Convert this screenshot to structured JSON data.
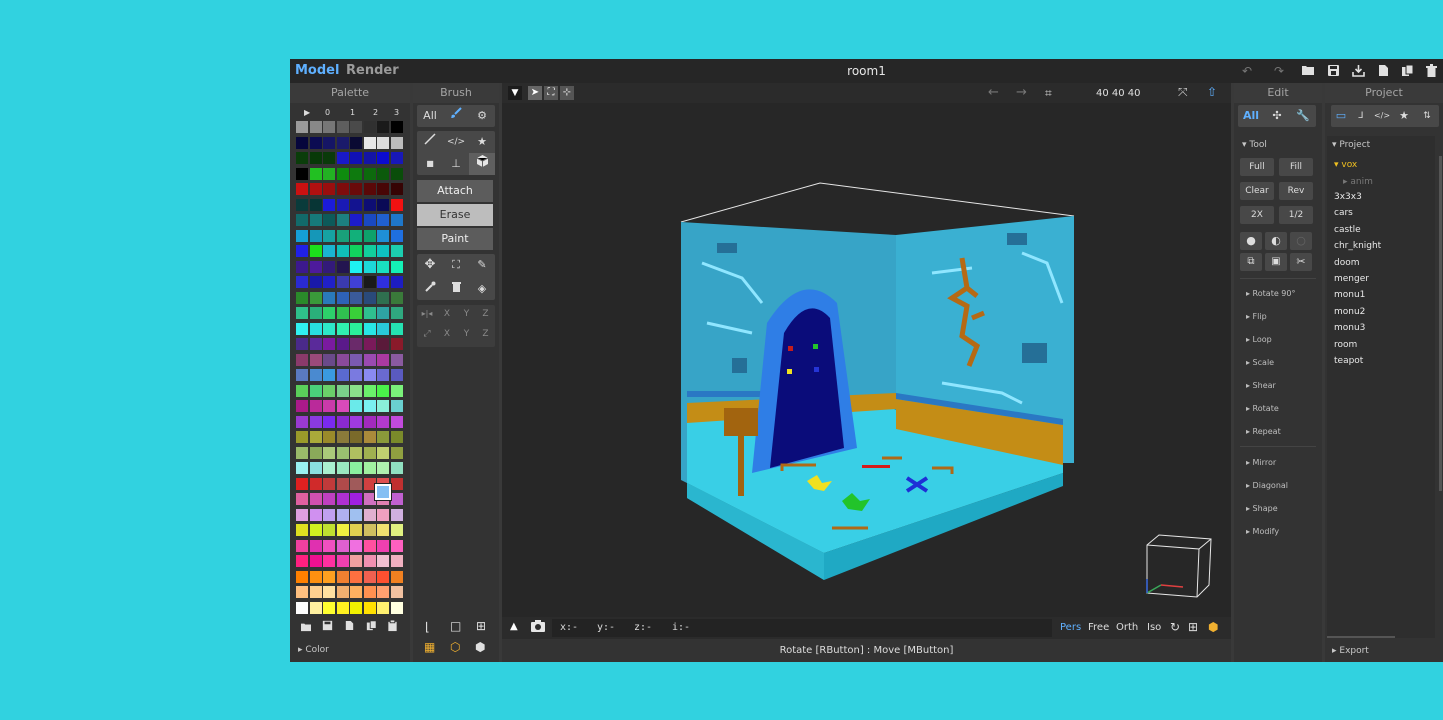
{
  "topbar": {
    "tabs": [
      "Model",
      "Render"
    ],
    "title": "room1"
  },
  "palette": {
    "title": "Palette",
    "columns": [
      "▶",
      "0",
      "1",
      "2",
      "3"
    ],
    "sub_label": "▸ Color",
    "colors": [
      "#9b9b9b",
      "#888888",
      "#777777",
      "#5e5e5e",
      "#4a4a4a",
      "#303030",
      "#1a1a1a",
      "#000000",
      "#06063c",
      "#0b0b52",
      "#151565",
      "#1a1a6b",
      "#0a0a33",
      "#e8e8e8",
      "#dedede",
      "#bcbcbc",
      "#0a3d0a",
      "#083908",
      "#0a3a0a",
      "#1919c8",
      "#1010b5",
      "#1414a5",
      "#0b0bd0",
      "#1818b8",
      "#000000",
      "#22c022",
      "#23b123",
      "#0e8c0e",
      "#0e7a0e",
      "#0d6a0d",
      "#0b5a0b",
      "#0a4d0a",
      "#cc1111",
      "#b01010",
      "#9a0e0e",
      "#7e0c0c",
      "#6a0a0a",
      "#5a0808",
      "#480606",
      "#360404",
      "#0a3b3b",
      "#073535",
      "#1b1bd9",
      "#1a1ab4",
      "#131390",
      "#0e0e74",
      "#0a0a56",
      "#f21111",
      "#126a6a",
      "#167a7a",
      "#0d5a5a",
      "#1c8080",
      "#1c1ccb",
      "#1a49c2",
      "#2060d0",
      "#1f77c9",
      "#15a0d8",
      "#1597b8",
      "#16a2a2",
      "#19a07a",
      "#12b07a",
      "#0ea26b",
      "#1f8fd6",
      "#1f6fe0",
      "#2020e8",
      "#1ce01c",
      "#1ab5d0",
      "#10c0b8",
      "#11d45e",
      "#12ce9c",
      "#0ec2c2",
      "#1ccdb0",
      "#3c198c",
      "#4d1a9c",
      "#331a7a",
      "#231550",
      "#1ef2f2",
      "#1dd9d9",
      "#19e0c0",
      "#14f0b6",
      "#2a2ad0",
      "#1919a8",
      "#2020c8",
      "#3a3ab0",
      "#4040d8",
      "#1a1a1a",
      "#2f2fde",
      "#1d1dc2",
      "#2a8a2a",
      "#3a9a3a",
      "#2a7aba",
      "#2e62b8",
      "#3a5a9a",
      "#2a4a7a",
      "#2f6f4f",
      "#3a7a3a",
      "#2fc08a",
      "#2ab07a",
      "#2dd06a",
      "#30c050",
      "#39cf39",
      "#2fbe8f",
      "#2ea3a3",
      "#2fa87f",
      "#30f0f0",
      "#28e0e0",
      "#2ee8c8",
      "#30f0b0",
      "#2af09a",
      "#28e6e6",
      "#29c9d9",
      "#25e2b2",
      "#4a2a8a",
      "#5a2a9a",
      "#7a1aa0",
      "#5a1a8a",
      "#6a2a6a",
      "#7a1a5a",
      "#5a1a3a",
      "#8a1a2a",
      "#8a3a6a",
      "#9a4a7a",
      "#6a4a8a",
      "#8a4a9a",
      "#7a5ab0",
      "#9a4ab0",
      "#aa3aa0",
      "#8a5aa0",
      "#5a7ac0",
      "#4a8ad0",
      "#3a9ae0",
      "#5a6ad0",
      "#7a7ae0",
      "#8a8af0",
      "#6a6ad0",
      "#5a5ac0",
      "#5ad05a",
      "#4ad07a",
      "#6ad06a",
      "#7ad08a",
      "#8ae08a",
      "#6af06a",
      "#4af04a",
      "#7af07a",
      "#aa1a8a",
      "#ba2a9a",
      "#ca3aaa",
      "#da4aba",
      "#6aeaea",
      "#7af0f0",
      "#8af0da",
      "#6ad0d0",
      "#9a3ad0",
      "#8a3ae0",
      "#7a2af0",
      "#8a2ad0",
      "#a03ae0",
      "#a22abd",
      "#b23acd",
      "#c24add",
      "#9a9a2a",
      "#aaaa3a",
      "#9a8a2a",
      "#8a7a3a",
      "#7a6a2a",
      "#aa8a3a",
      "#8a9a3a",
      "#7a8a2a",
      "#9aba6a",
      "#8aaa5a",
      "#aaca7a",
      "#9ac070",
      "#b0c060",
      "#a0b050",
      "#c0d070",
      "#90a040",
      "#9af0f0",
      "#8ae0e0",
      "#aaf0d0",
      "#9ae8c0",
      "#8af0a0",
      "#a0f0a0",
      "#b0f0b0",
      "#90e0c0",
      "#e02020",
      "#d02a2a",
      "#c03a3a",
      "#b04a4a",
      "#a05a5a",
      "#d04040",
      "#e05050",
      "#c03030",
      "#e060a0",
      "#d050b0",
      "#c040c0",
      "#b030d0",
      "#a020e0",
      "#d070c0",
      "#e080b0",
      "#c060d0",
      "#e0a0e0",
      "#d090f0",
      "#c0a0f0",
      "#b0b0f0",
      "#a0c0f0",
      "#e0b0d0",
      "#f0a0c0",
      "#d0b0e0",
      "#e0e020",
      "#d0f020",
      "#c0e030",
      "#f0f040",
      "#e0d050",
      "#d0c060",
      "#f0e070",
      "#e0f080",
      "#f040a0",
      "#e030b0",
      "#f050c0",
      "#e060d0",
      "#f070e0",
      "#ff50a0",
      "#ef40b0",
      "#ff60c0",
      "#ff2080",
      "#ef1090",
      "#ff30a0",
      "#ef40b0",
      "#f0a0a0",
      "#f090b0",
      "#f0c0d0",
      "#f0b0c0",
      "#ff8000",
      "#ff9010",
      "#ffa020",
      "#f08030",
      "#ff7040",
      "#f06050",
      "#ff5030",
      "#f08020",
      "#ffc080",
      "#ffd090",
      "#ffe0a0",
      "#f0b070",
      "#ffb060",
      "#ff9050",
      "#ffa070",
      "#f0c0a0",
      "#ffffff",
      "#fff0a0",
      "#ffff30",
      "#fff020",
      "#f0f000",
      "#ffe000",
      "#fff070",
      "#ffffe0"
    ],
    "selected": "#85bff3"
  },
  "brush": {
    "title": "Brush",
    "filter_all": "All",
    "modes": [
      "Attach",
      "Erase",
      "Paint"
    ],
    "axis_labels": [
      "X",
      "Y",
      "Z"
    ]
  },
  "viewport": {
    "size_readout": "40  40  40",
    "coords": {
      "x": "x:-",
      "y": "y:-",
      "z": "z:-",
      "i": "i:-"
    },
    "camera_modes": [
      "Pers",
      "Free",
      "Orth",
      "Iso"
    ],
    "active_camera": "Pers",
    "status": "Rotate [RButton] : Move [MButton]"
  },
  "edit": {
    "title": "Edit",
    "filter_all": "All",
    "tool_header": "▾ Tool",
    "tool_buttons": [
      [
        "Full",
        "Fill"
      ],
      [
        "Clear",
        "Rev"
      ],
      [
        "2X",
        "1/2"
      ]
    ],
    "actions": [
      "▸ Rotate 90°",
      "▸ Flip",
      "▸ Loop",
      "▸ Scale",
      "▸ Shear",
      "▸ Rotate",
      "▸ Repeat"
    ],
    "actions2": [
      "▸ Mirror",
      "▸ Diagonal",
      "▸ Shape",
      "▸ Modify"
    ]
  },
  "project": {
    "title": "Project",
    "header": "▾ Project",
    "folder_open": "▾ vox",
    "sub_item": "▸ anim",
    "items": [
      "3x3x3",
      "cars",
      "castle",
      "chr_knight",
      "doom",
      "menger",
      "monu1",
      "monu2",
      "monu3",
      "room",
      "teapot"
    ],
    "export": "▸ Export"
  },
  "colors": {
    "accent": "#5fb0ff",
    "folder": "#f0c020",
    "background": "#31d2e0"
  }
}
